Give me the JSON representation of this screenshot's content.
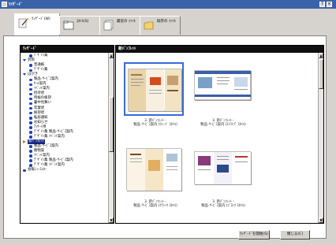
{
  "window": {
    "title": "ﾜｲｻﾞｰﾄﾞ",
    "controls": [
      "?",
      "×"
    ]
  },
  "tabs": [
    {
      "label": "ｳｨｻﾞｰﾄﾞ(W)",
      "icon": "wand-icon"
    },
    {
      "label": "ｽﾀｲﾙ(S)",
      "icon": "folder-icon"
    },
    {
      "label": "最近の ﾌｧｲﾙ",
      "icon": "document-stack-icon"
    },
    {
      "label": "既存の ﾌｧｲﾙ",
      "icon": "folder-open-icon"
    }
  ],
  "left_pane": {
    "header": "ｳｨｻﾞｰﾄﾞ",
    "items": [
      {
        "label": "ﾃﾞｻﾞｲﾝ集",
        "level": 1,
        "kind": "dot"
      },
      {
        "label": "封筒",
        "level": 0,
        "kind": "tri"
      },
      {
        "label": "普通紙",
        "level": 1,
        "kind": "dot"
      },
      {
        "label": "ﾃﾞｻﾞｲﾝ集",
        "level": 1,
        "kind": "dot"
      },
      {
        "label": "はがき",
        "level": 0,
        "kind": "tri"
      },
      {
        "label": "製品･ｻｰﾋﾞｽ案内",
        "level": 1,
        "kind": "dot"
      },
      {
        "label": "ｾｰﾙ案内",
        "level": 1,
        "kind": "dot"
      },
      {
        "label": "ｲﾍﾞﾝﾄ案内",
        "level": 1,
        "kind": "dot"
      },
      {
        "label": "招待状",
        "level": 1,
        "kind": "dot"
      },
      {
        "label": "時候の挨拶",
        "level": 1,
        "kind": "dot"
      },
      {
        "label": "暑中見舞い",
        "level": 1,
        "kind": "dot"
      },
      {
        "label": "年賀状",
        "level": 1,
        "kind": "dot"
      },
      {
        "label": "挨拶状",
        "level": 1,
        "kind": "dot"
      },
      {
        "label": "転居通知",
        "level": 1,
        "kind": "dot"
      },
      {
        "label": "お知らせ",
        "level": 1,
        "kind": "dot"
      },
      {
        "label": "ｱﾝｹｰﾄ用",
        "level": 1,
        "kind": "dot"
      },
      {
        "label": "ﾃﾞｻﾞｲﾝ集 製品･ｻｰﾋﾞｽ案内",
        "level": 1,
        "kind": "dot"
      },
      {
        "label": "ﾃﾞｻﾞｲﾝ集 ｲﾍﾞﾝﾄ案内",
        "level": 1,
        "kind": "dot"
      },
      {
        "label": "新ﾊﾟﾝﾌﾚｯﾄ",
        "level": 0,
        "kind": "arrow",
        "selected": true
      },
      {
        "label": "製品･ｻｰﾋﾞｽ案内",
        "level": 1,
        "kind": "dot"
      },
      {
        "label": "催物案",
        "level": 1,
        "kind": "dot"
      },
      {
        "label": "ｲﾍﾞﾝﾄ案内",
        "level": 1,
        "kind": "dot"
      },
      {
        "label": "ﾃﾞｻﾞｲﾝ集 製品･ｻｰﾋﾞｽ案内",
        "level": 1,
        "kind": "dot"
      },
      {
        "label": "ﾃﾞｻﾞｲﾝ集 ｲﾍﾞﾝﾄ案内",
        "level": 1,
        "kind": "dot"
      },
      {
        "label": "会報ﾆｭｰｽﾚﾀｰ",
        "level": 0,
        "kind": "dot"
      }
    ]
  },
  "right_pane": {
    "header": "新ﾊﾟﾝﾌﾚｯﾄ",
    "thumbnails": [
      {
        "caption_line1": "3. 新ﾊﾟﾝﾌﾚｯﾄ -",
        "caption_line2": "製品･ｻｰﾋﾞｽ案内 (ｳｪｰﾌﾞ ｽﾀｲﾙ)",
        "selected": true
      },
      {
        "caption_line1": "3. 新ﾊﾟﾝﾌﾚｯﾄ -",
        "caption_line2": "製品･ｻｰﾋﾞｽ案内 (ｽﾄﾗｲﾌﾟ ｽﾀｲﾙ)",
        "selected": false
      },
      {
        "caption_line1": "3. 新ﾊﾟﾝﾌﾚｯﾄ -",
        "caption_line2": "製品･ｻｰﾋﾞｽ案内 (ｸﾗｼｯｸ ｽﾀｲﾙ)",
        "selected": false
      },
      {
        "caption_line1": "3. 新ﾊﾟﾝﾌﾚｯﾄ -",
        "caption_line2": "製品･ｻｰﾋﾞｽ案内 (ﾌﾞﾛｯｸ ｽﾀｲﾙ)",
        "selected": false
      }
    ]
  },
  "buttons": {
    "start_wizard": "ｳｨｻﾞｰﾄﾞを開始(S)",
    "close": "閉じる(C)"
  },
  "colors": {
    "title_bar": "#3a62a8",
    "pane_header": "#101010",
    "tree_bullet": "#1f3fbf",
    "selection": "#1a2d8a",
    "thumb_selected_border": "#3a6ad8"
  }
}
